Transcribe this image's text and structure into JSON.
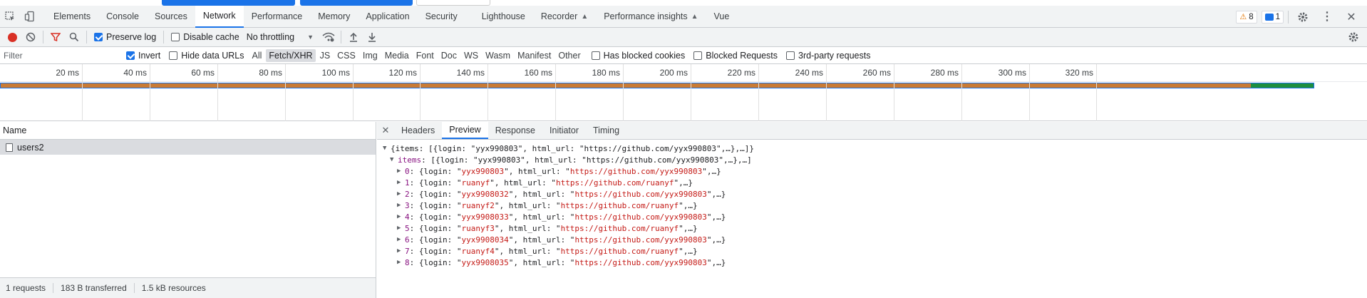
{
  "tabbar": {
    "tabs": [
      "Elements",
      "Console",
      "Sources",
      "Network",
      "Performance",
      "Memory",
      "Application",
      "Security",
      "Lighthouse",
      "Recorder",
      "Performance insights",
      "Vue"
    ],
    "active": "Network",
    "warnings_count": "8",
    "messages_count": "1"
  },
  "toolbar": {
    "preserve_log": "Preserve log",
    "disable_cache": "Disable cache",
    "throttling": "No throttling"
  },
  "filterbar": {
    "placeholder": "Filter",
    "invert": "Invert",
    "hide_data_urls": "Hide data URLs",
    "types": [
      "All",
      "Fetch/XHR",
      "JS",
      "CSS",
      "Img",
      "Media",
      "Font",
      "Doc",
      "WS",
      "Wasm",
      "Manifest",
      "Other"
    ],
    "active_type": "Fetch/XHR",
    "has_blocked_cookies": "Has blocked cookies",
    "blocked_requests": "Blocked Requests",
    "third_party": "3rd-party requests"
  },
  "overview": {
    "ticks": [
      "20 ms",
      "40 ms",
      "60 ms",
      "80 ms",
      "100 ms",
      "120 ms",
      "140 ms",
      "160 ms",
      "180 ms",
      "200 ms",
      "220 ms",
      "240 ms",
      "260 ms",
      "280 ms",
      "300 ms",
      "320 ms"
    ]
  },
  "requests": {
    "column_name": "Name",
    "items": [
      {
        "name": "users2"
      }
    ]
  },
  "status": {
    "requests": "1 requests",
    "transferred": "183 B transferred",
    "resources": "1.5 kB resources"
  },
  "panel": {
    "tabs": [
      "Headers",
      "Preview",
      "Response",
      "Initiator",
      "Timing"
    ],
    "active": "Preview"
  },
  "preview": {
    "root": "{items: [{login: \"yyx990803\", html_url: \"https://github.com/yyx990803\",…},…]}",
    "items_key": "items",
    "items_summary": "[{login: \"yyx990803\", html_url: \"https://github.com/yyx990803\",…},…]",
    "entries": [
      {
        "index": "0",
        "login": "yyx990803",
        "html_url": "https://github.com/yyx990803"
      },
      {
        "index": "1",
        "login": "ruanyf",
        "html_url": "https://github.com/ruanyf"
      },
      {
        "index": "2",
        "login": "yyx9908032",
        "html_url": "https://github.com/yyx990803"
      },
      {
        "index": "3",
        "login": "ruanyf2",
        "html_url": "https://github.com/ruanyf"
      },
      {
        "index": "4",
        "login": "yyx9908033",
        "html_url": "https://github.com/yyx990803"
      },
      {
        "index": "5",
        "login": "ruanyf3",
        "html_url": "https://github.com/ruanyf"
      },
      {
        "index": "6",
        "login": "yyx9908034",
        "html_url": "https://github.com/yyx990803"
      },
      {
        "index": "7",
        "login": "ruanyf4",
        "html_url": "https://github.com/ruanyf"
      },
      {
        "index": "8",
        "login": "yyx9908035",
        "html_url": "https://github.com/yyx990803"
      }
    ]
  }
}
